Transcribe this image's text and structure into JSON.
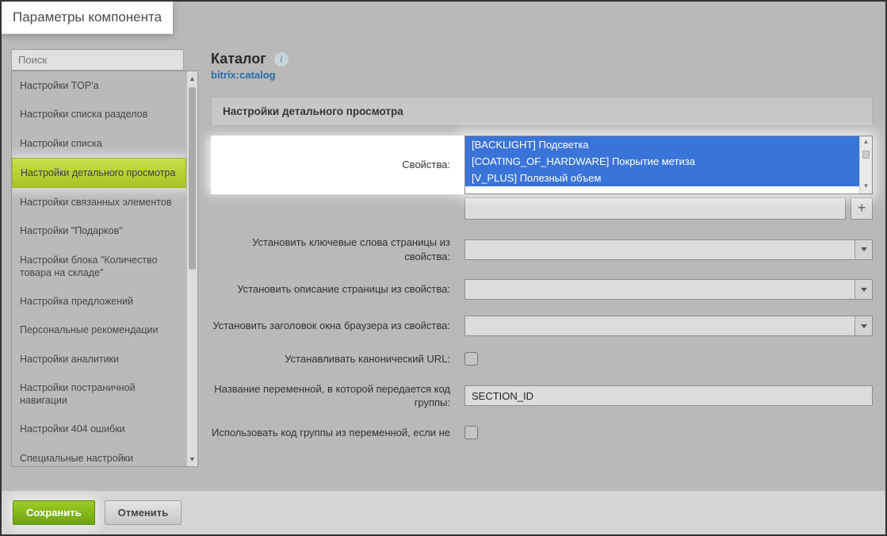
{
  "title": "Параметры компонента",
  "search": {
    "placeholder": "Поиск"
  },
  "sidebar": {
    "items": [
      {
        "label": "Настройки TOP'а"
      },
      {
        "label": "Настройки списка разделов"
      },
      {
        "label": "Настройки списка"
      },
      {
        "label": "Настройки детального просмотра"
      },
      {
        "label": "Настройки связанных элементов"
      },
      {
        "label": "Настройки \"Подарков\""
      },
      {
        "label": "Настройки блока \"Количество товара на складе\""
      },
      {
        "label": "Настройка предложений"
      },
      {
        "label": "Персональные рекомендации"
      },
      {
        "label": "Настройки аналитики"
      },
      {
        "label": "Настройки постраничной навигации"
      },
      {
        "label": "Настройки 404 ошибки"
      },
      {
        "label": "Специальные настройки"
      }
    ],
    "activeIndex": 3
  },
  "header": {
    "title": "Каталог",
    "component": "bitrix:catalog"
  },
  "section_heading": "Настройки детального просмотра",
  "form": {
    "properties_label": "Свойства:",
    "properties_options": [
      "[BACKLIGHT] Подсветка",
      "[COATING_OF_HARDWARE] Покрытие метиза",
      "[V_PLUS] Полезный объем"
    ],
    "keywords_label": "Установить ключевые слова страницы из свойства:",
    "description_label": "Установить описание страницы из свойства:",
    "browser_title_label": "Установить заголовок окна браузера из свойства:",
    "canonical_label": "Устанавливать канонический URL:",
    "section_var_label": "Название переменной, в которой передается код группы:",
    "section_var_value": "SECTION_ID",
    "use_group_code_label": "Использовать код группы из переменной, если не"
  },
  "footer": {
    "save": "Сохранить",
    "cancel": "Отменить"
  }
}
